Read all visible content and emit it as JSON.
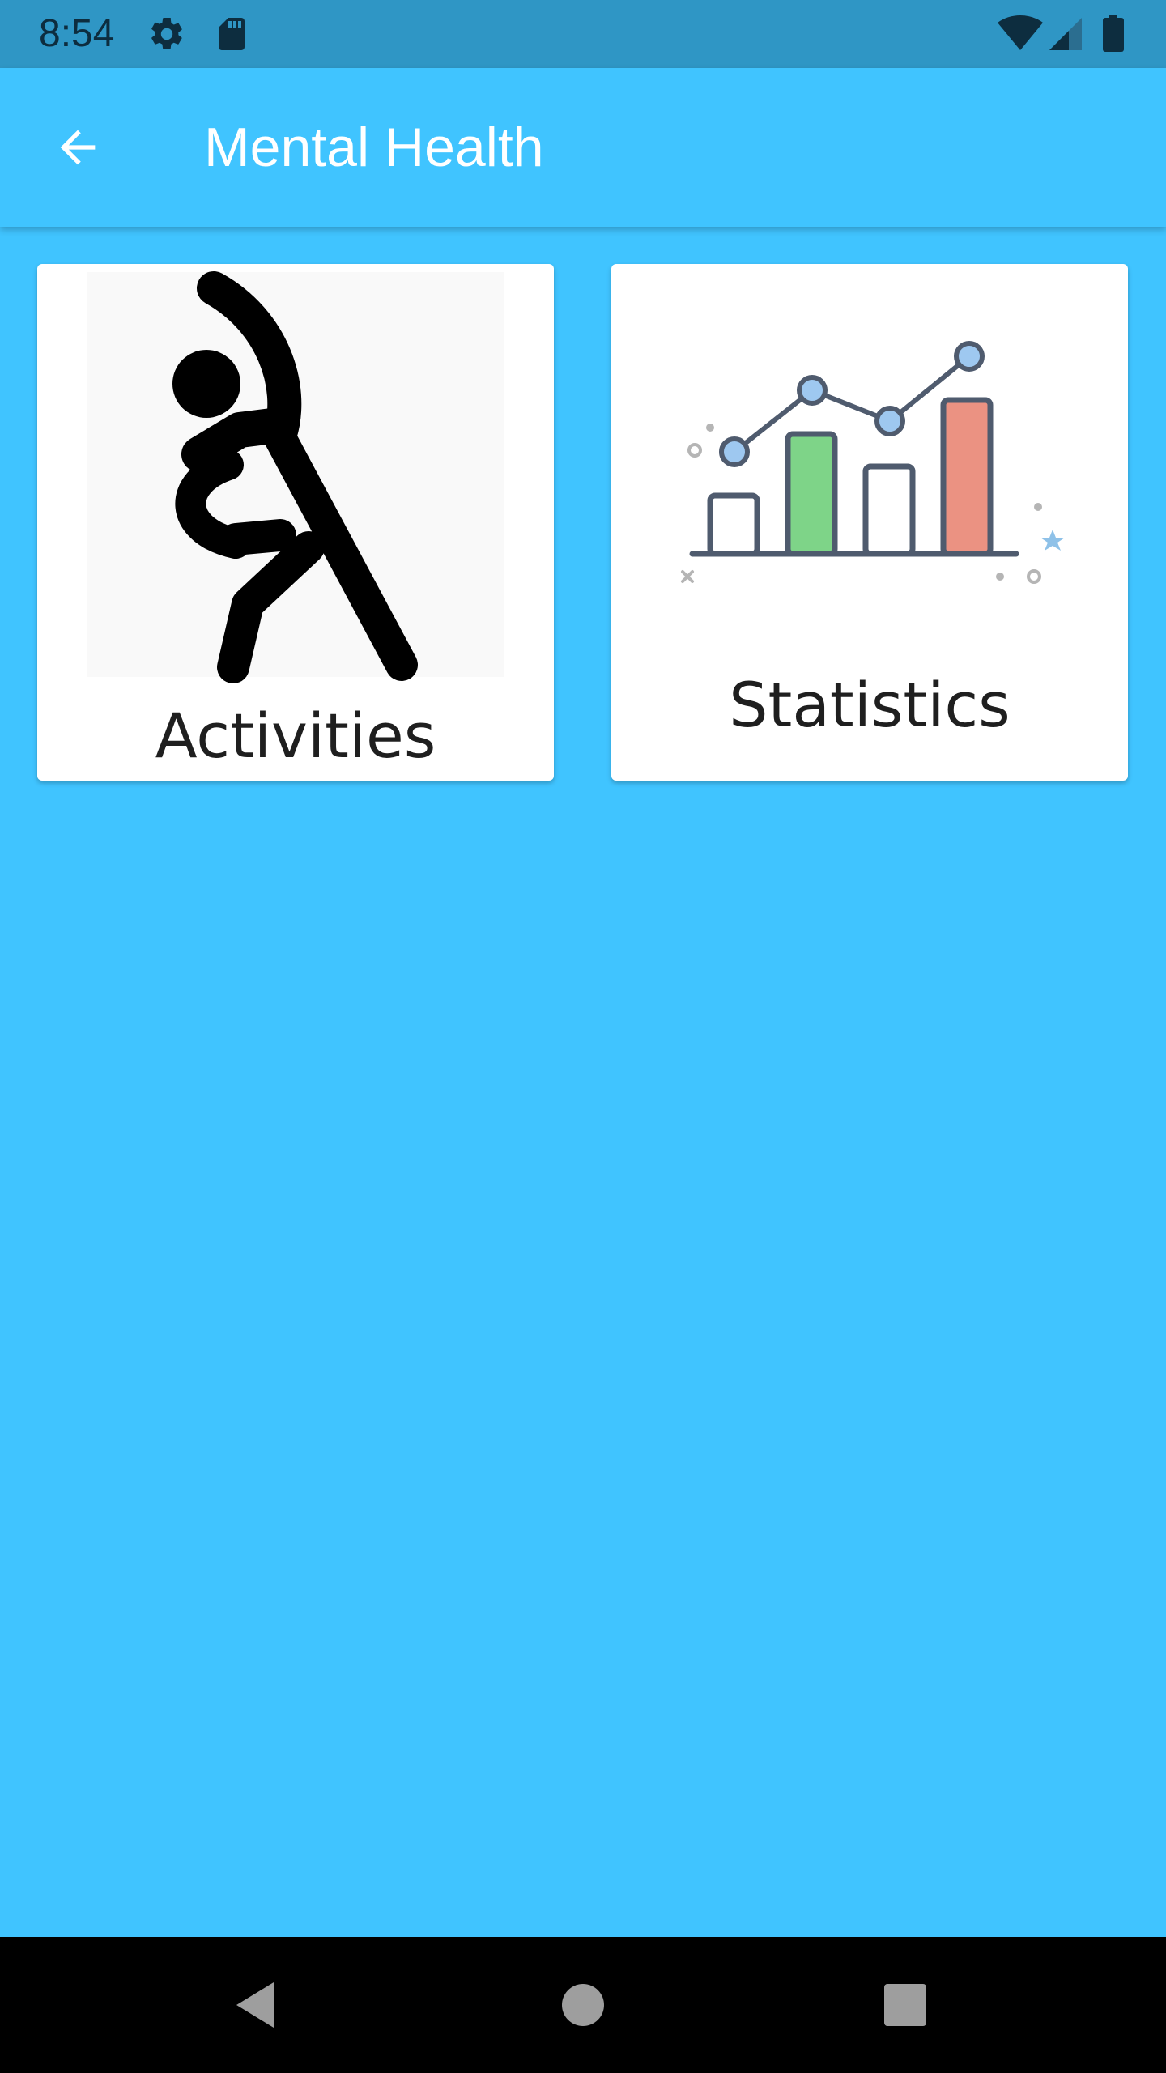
{
  "status_bar": {
    "time": "8:54",
    "icons": [
      "settings-icon",
      "sd-card-icon",
      "wifi-icon",
      "signal-icon",
      "battery-icon"
    ]
  },
  "app_bar": {
    "title": "Mental Health",
    "back_icon": "arrow-back-icon"
  },
  "cards": [
    {
      "label": "Activities",
      "icon": "stretching-person-icon"
    },
    {
      "label": "Statistics",
      "icon": "bar-line-chart-icon"
    }
  ],
  "nav_bar": {
    "buttons": [
      "back-triangle-icon",
      "home-circle-icon",
      "recents-square-icon"
    ]
  },
  "colors": {
    "background": "#40C4FF",
    "status_bar": "#2F96C5",
    "card": "#FFFFFF",
    "nav_bar": "#000000"
  }
}
